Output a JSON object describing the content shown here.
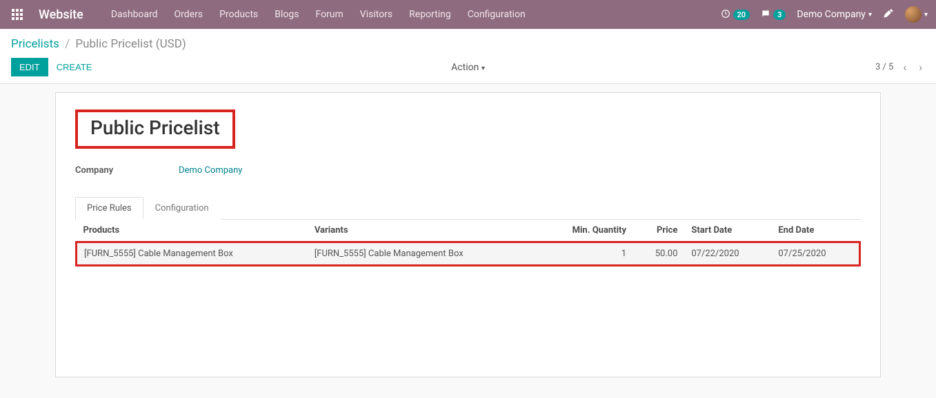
{
  "nav": {
    "brand": "Website",
    "items": [
      "Dashboard",
      "Orders",
      "Products",
      "Blogs",
      "Forum",
      "Visitors",
      "Reporting",
      "Configuration"
    ],
    "clock_badge": "20",
    "chat_badge": "3",
    "company": "Demo Company"
  },
  "breadcrumb": {
    "root": "Pricelists",
    "current": "Public Pricelist (USD)"
  },
  "buttons": {
    "edit": "EDIT",
    "create": "CREATE",
    "action": "Action"
  },
  "pager": {
    "pos": "3 / 5"
  },
  "record": {
    "title": "Public Pricelist",
    "company_label": "Company",
    "company_value": "Demo Company"
  },
  "tabs": {
    "price_rules": "Price Rules",
    "configuration": "Configuration"
  },
  "table": {
    "headers": {
      "products": "Products",
      "variants": "Variants",
      "min_qty": "Min. Quantity",
      "price": "Price",
      "start": "Start Date",
      "end": "End Date"
    },
    "rows": [
      {
        "product": "[FURN_5555] Cable Management Box",
        "variant": "[FURN_5555] Cable Management Box",
        "min_qty": "1",
        "price": "50.00",
        "start": "07/22/2020",
        "end": "07/25/2020"
      }
    ]
  }
}
